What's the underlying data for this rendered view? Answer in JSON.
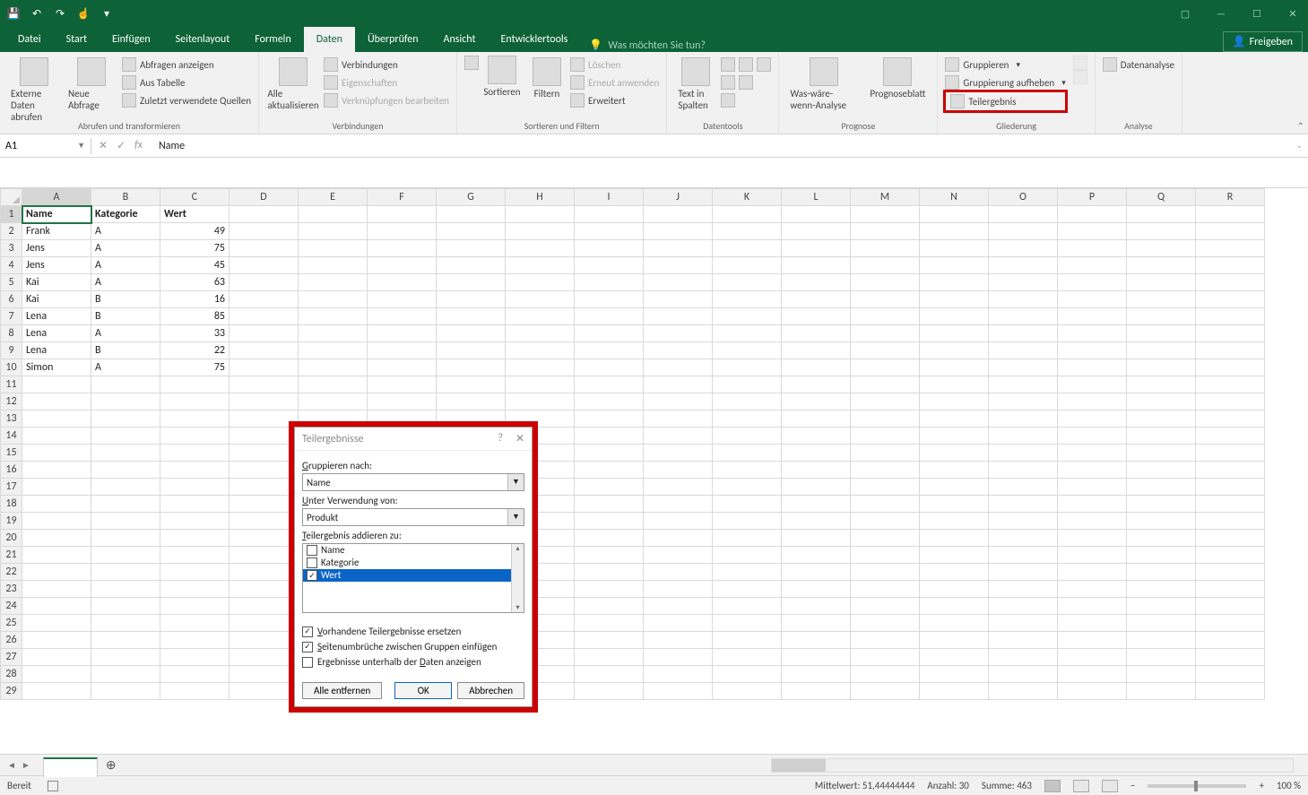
{
  "app": {
    "qat_icons": [
      "save",
      "undo",
      "redo",
      "touch",
      "customize"
    ]
  },
  "window_controls": [
    "card",
    "minimize",
    "maximize",
    "close"
  ],
  "share_label": "Freigeben",
  "tabs": [
    "Datei",
    "Start",
    "Einfügen",
    "Seitenlayout",
    "Formeln",
    "Daten",
    "Überprüfen",
    "Ansicht",
    "Entwicklertools"
  ],
  "active_tab": "Daten",
  "tell_me_placeholder": "Was möchten Sie tun?",
  "ribbon": {
    "g1": {
      "big1": "Externe Daten abrufen",
      "big2": "Neue Abfrage",
      "r1": "Abfragen anzeigen",
      "r2": "Aus Tabelle",
      "r3": "Zuletzt verwendete Quellen",
      "title": "Abrufen und transformieren"
    },
    "g2": {
      "big": "Alle aktualisieren",
      "r1": "Verbindungen",
      "r2": "Eigenschaften",
      "r3": "Verknüpfungen bearbeiten",
      "title": "Verbindungen"
    },
    "g3": {
      "sort": "Sortieren",
      "filter": "Filtern",
      "r1": "Löschen",
      "r2": "Erneut anwenden",
      "r3": "Erweitert",
      "title": "Sortieren und Filtern"
    },
    "g4": {
      "big": "Text in Spalten",
      "title": "Datentools"
    },
    "g5": {
      "b1": "Was-wäre-wenn-Analyse",
      "b2": "Prognoseblatt",
      "title": "Prognose"
    },
    "g6": {
      "r1": "Gruppieren",
      "r2": "Gruppierung aufheben",
      "r3": "Teilergebnis",
      "title": "Gliederung"
    },
    "g7": {
      "r1": "Datenanalyse",
      "title": "Analyse"
    }
  },
  "name_box": "A1",
  "formula": "Name",
  "columns": [
    "A",
    "B",
    "C",
    "D",
    "E",
    "F",
    "G",
    "H",
    "I",
    "J",
    "K",
    "L",
    "M",
    "N",
    "O",
    "P",
    "Q",
    "R"
  ],
  "rows": 29,
  "headers": [
    "Name",
    "Kategorie",
    "Wert"
  ],
  "data_rows": [
    [
      "Frank",
      "A",
      "49"
    ],
    [
      "Jens",
      "A",
      "75"
    ],
    [
      "Jens",
      "A",
      "45"
    ],
    [
      "Kai",
      "A",
      "63"
    ],
    [
      "Kai",
      "B",
      "16"
    ],
    [
      "Lena",
      "B",
      "85"
    ],
    [
      "Lena",
      "A",
      "33"
    ],
    [
      "Lena",
      "B",
      "22"
    ],
    [
      "Simon",
      "A",
      "75"
    ]
  ],
  "dialog": {
    "title": "Teilergebnisse",
    "lbl_group": "Gruppieren nach:",
    "val_group": "Name",
    "lbl_func": "Unter Verwendung von:",
    "val_func": "Produkt",
    "lbl_add": "Teilergebnis addieren zu:",
    "fields": [
      {
        "label": "Name",
        "checked": false,
        "sel": false
      },
      {
        "label": "Kategorie",
        "checked": false,
        "sel": false
      },
      {
        "label": "Wert",
        "checked": true,
        "sel": true
      }
    ],
    "chk_replace_label": "Vorhandene Teilergebnisse ersetzen",
    "chk_replace": true,
    "chk_pagebreak_label": "Seitenumbrüche zwischen Gruppen einfügen",
    "chk_pagebreak": true,
    "chk_below_label": "Ergebnisse unterhalb der Daten anzeigen",
    "chk_below": false,
    "btn_remove": "Alle entfernen",
    "btn_ok": "OK",
    "btn_cancel": "Abbrechen"
  },
  "sheet_tab": "",
  "status": {
    "ready": "Bereit",
    "avg_label": "Mittelwert:",
    "avg": "51,44444444",
    "count_label": "Anzahl:",
    "count": "30",
    "sum_label": "Summe:",
    "sum": "463",
    "zoom": "100 %"
  }
}
